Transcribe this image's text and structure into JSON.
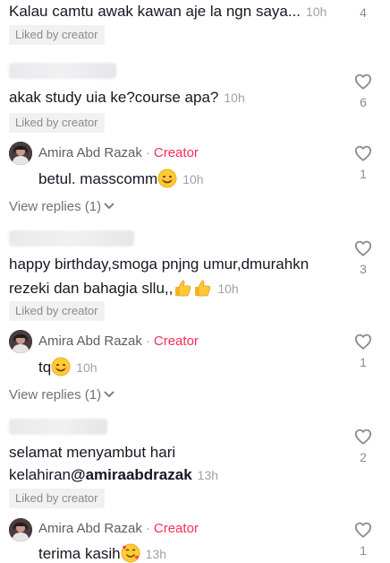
{
  "comments": [
    {
      "text": "Kalau camtu awak kawan aje la ngn saya...",
      "time": "10h",
      "badge": "Liked by creator",
      "likes": "4"
    },
    {
      "text": "akak study uia ke?course apa?",
      "time": "10h",
      "badge": "Liked by creator",
      "likes": "6",
      "reply": {
        "name": "Amira Abd Razak",
        "separator": "·",
        "role": "Creator",
        "text": "betul. masscomm",
        "emoji": "smiling-face-icon",
        "time": "10h",
        "likes": "1"
      },
      "view_replies": "View replies (1)"
    },
    {
      "text_line1": "happy birthday,smoga pnjng umur,dmurahkn",
      "text_line2": "rezeki dan bahagia sllu,,",
      "emoji": "thumbs-up-icon",
      "time": "10h",
      "badge": "Liked by creator",
      "likes": "3",
      "reply": {
        "name": "Amira Abd Razak",
        "separator": "·",
        "role": "Creator",
        "text": "tq",
        "emoji": "smiling-face-icon",
        "time": "10h",
        "likes": "1"
      },
      "view_replies": "View replies (1)"
    },
    {
      "text_line1": "selamat menyambut hari",
      "text_line2_prefix": "kelahiran",
      "mention": "@amiraabdrazak",
      "time": "13h",
      "badge": "Liked by creator",
      "likes": "2",
      "reply": {
        "name": "Amira Abd Razak",
        "separator": "·",
        "role": "Creator",
        "text": "terima kasih",
        "emoji": "smiling-face-with-hearts-icon",
        "time": "13h",
        "likes": "1"
      }
    }
  ],
  "colors": {
    "creator": "#fe2c55",
    "time": "#a0a1a6",
    "badge_bg": "#f1f1f2",
    "text": "#161823"
  }
}
